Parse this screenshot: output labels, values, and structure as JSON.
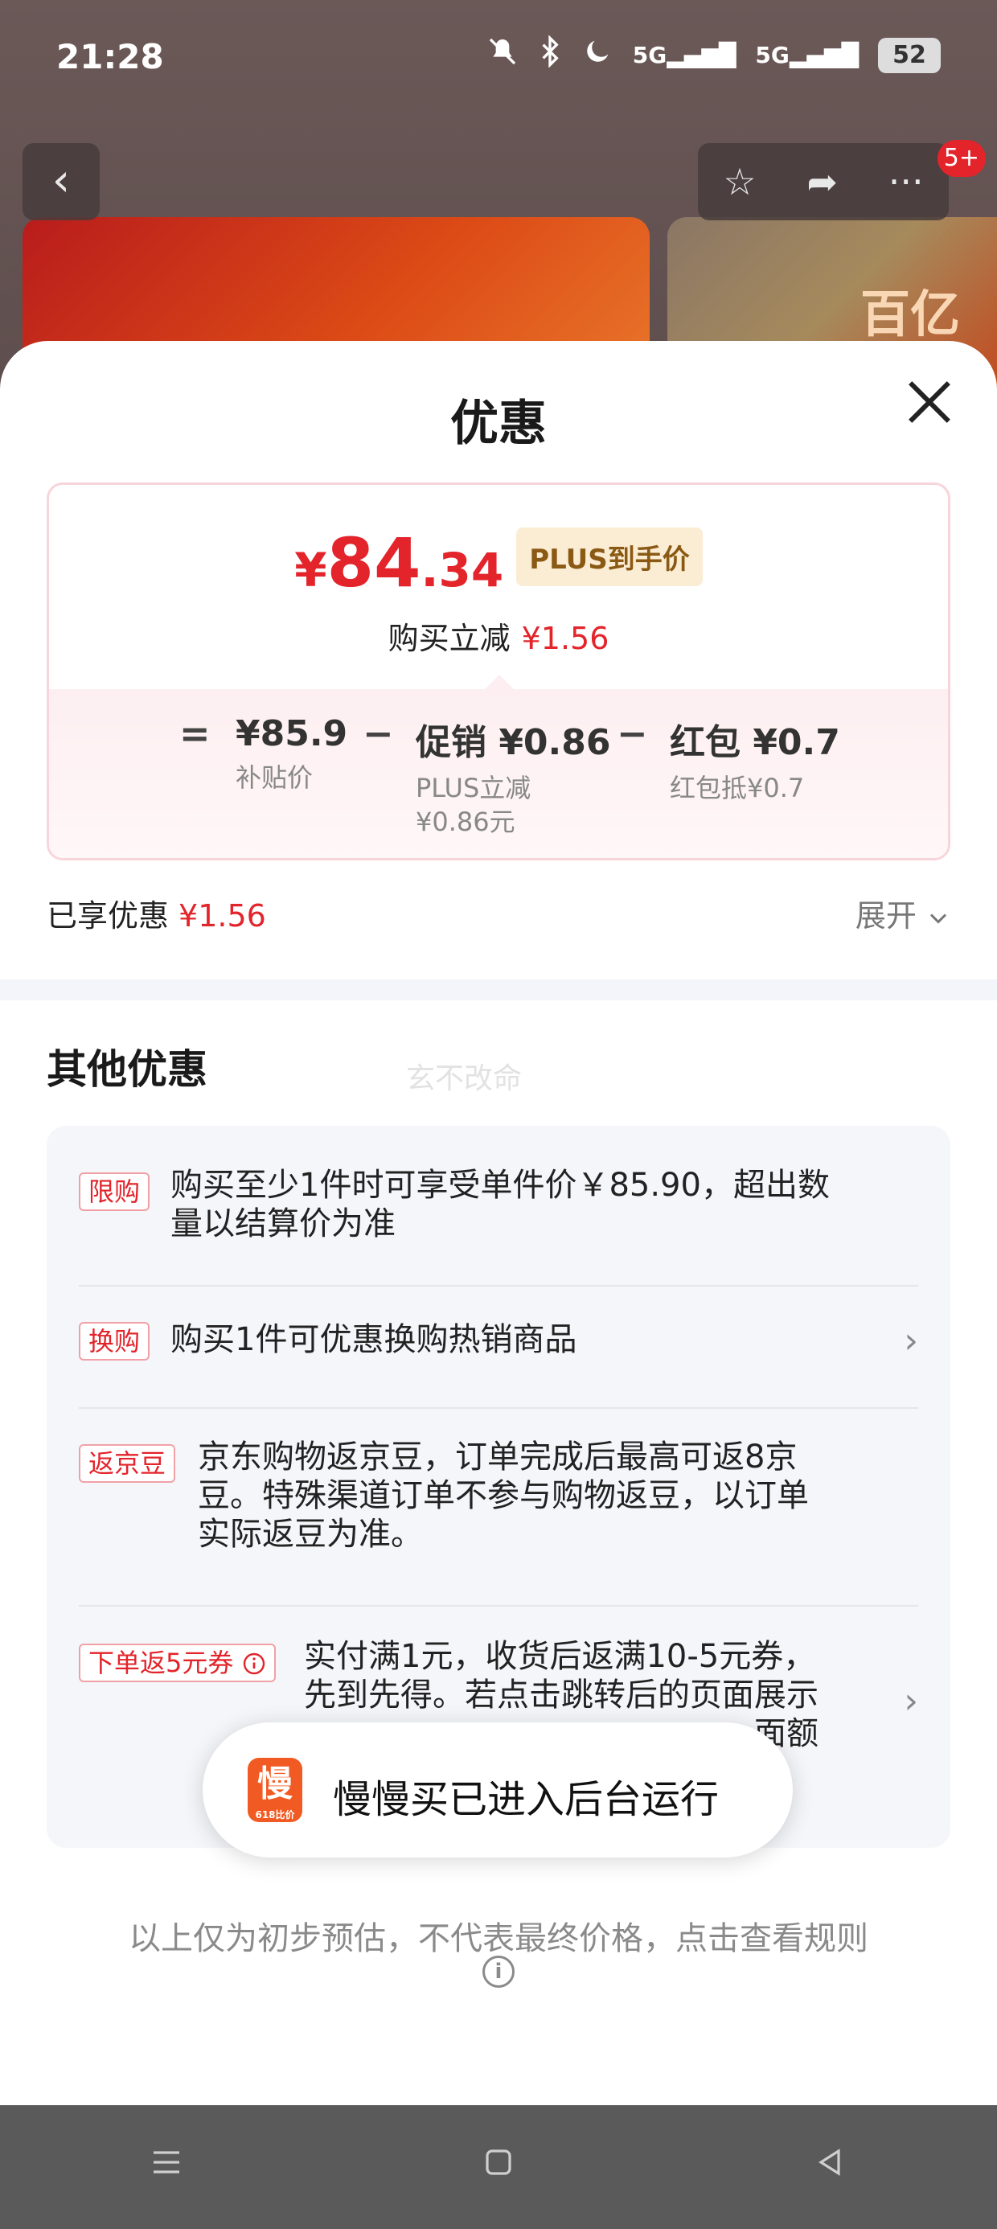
{
  "status_bar": {
    "time": "21:28",
    "network1": "5G",
    "network2": "5G",
    "battery": "52"
  },
  "nav": {
    "badge": "5+"
  },
  "hero": {
    "label": "百亿"
  },
  "sheet": {
    "title": "优惠",
    "price_card": {
      "currency": "¥",
      "price_int": "84",
      "price_dec": ".34",
      "plus_tag": "PLUS到手价",
      "reduce_label": "购买立减",
      "reduce_amount": "¥1.56",
      "eq": "=",
      "minus": "−",
      "subsidy_value": "¥85.9",
      "subsidy_label": "补贴价",
      "promo_value": "促销 ¥0.86",
      "promo_sub1": "PLUS立减",
      "promo_sub2": "¥0.86元",
      "redpack_value": "红包 ¥0.7",
      "redpack_sub": "红包抵¥0.7"
    },
    "enjoyed_label": "已享优惠",
    "enjoyed_amount": "¥1.56",
    "expand_label": "展开",
    "other_title": "其他优惠",
    "watermark": "玄不改命",
    "offers": [
      {
        "tag": "限购",
        "line1": "购买至少1件时可享受单件价￥85.90，超出数",
        "line2": "量以结算价为准"
      },
      {
        "tag": "换购",
        "line1": "购买1件可优惠换购热销商品"
      },
      {
        "tag": "返京豆",
        "line1": "京东购物返京豆，订单完成后最高可返8京",
        "line2": "豆。特殊渠道订单不参与购物返豆，以订单",
        "line3": "实际返豆为准。"
      },
      {
        "tag": "下单返5元券",
        "line1": "实付满1元，收货后返满10-5元券，",
        "line2": "先到先得。若点击跳转后的页面展示",
        "line3": "面额"
      }
    ],
    "footer_note": "以上仅为初步预估，不代表最终价格，点击查看规则"
  },
  "toast": {
    "logo_char": "慢",
    "logo_sub": "618比价",
    "text": "慢慢买已进入后台运行"
  },
  "colors": {
    "accent_red": "#e3242b",
    "plus_gold": "#8a5a15"
  }
}
